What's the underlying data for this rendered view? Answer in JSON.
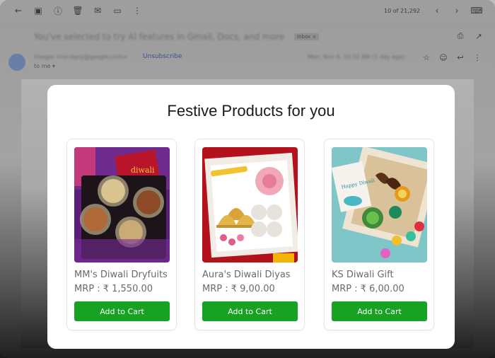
{
  "gmail": {
    "count": "10 of 21,292",
    "subject": "You've selected to try AI features in Gmail, Docs, and more",
    "label_chip": "Inbox ×",
    "sender": "Google <no-reply@google.com>",
    "unsubscribe": "Unsubscribe",
    "to_me": "to me ▾",
    "date": "Mon, Nov 4, 10:32 AM (1 day ago)"
  },
  "modal": {
    "title": "Festive Products for you",
    "products": [
      {
        "name": "MM's Diwali Dryfuits",
        "price": "MRP : ₹ 1,550.00",
        "button": "Add to Cart"
      },
      {
        "name": "Aura's Diwali Diyas",
        "price": "MRP : ₹ 9,00.00",
        "button": "Add to Cart"
      },
      {
        "name": "KS Diwali Gift",
        "price": "MRP : ₹ 6,00.00",
        "button": "Add to Cart"
      }
    ]
  },
  "icons": {
    "back": "arrow-left-icon",
    "archive": "archive-icon",
    "report": "report-icon",
    "delete": "trash-icon",
    "mail": "mail-icon",
    "move": "folder-icon",
    "more": "more-vert-icon",
    "prev": "chevron-left-icon",
    "next": "chevron-right-icon",
    "keyboard": "keyboard-icon",
    "print": "print-icon",
    "open": "open-new-icon",
    "star": "star-icon",
    "emoji": "emoji-icon",
    "reply": "reply-icon"
  },
  "colors": {
    "cta_green": "#17a223"
  }
}
